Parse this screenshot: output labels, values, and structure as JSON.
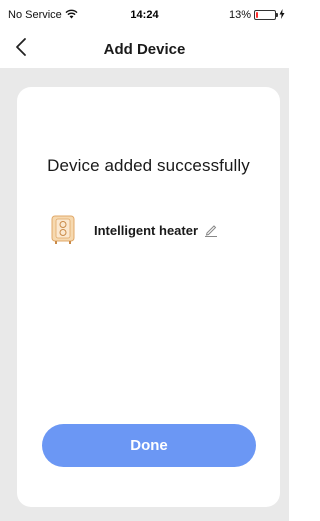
{
  "status_bar": {
    "carrier": "No Service",
    "time": "14:24",
    "battery_percent": "13%",
    "battery_level": 0.13,
    "battery_color": "#ff2d2d",
    "wifi_icon": "wifi-icon",
    "charging_icon": "charging-bolt-icon"
  },
  "nav": {
    "title": "Add Device",
    "back_icon": "chevron-left-icon"
  },
  "card": {
    "title": "Device added successfully",
    "device": {
      "name": "Intelligent heater",
      "icon": "heater-icon",
      "edit_icon": "pencil-edit-icon"
    },
    "done_label": "Done"
  },
  "colors": {
    "accent": "#6b97f4",
    "background": "#e9e9e9",
    "card": "#ffffff"
  }
}
